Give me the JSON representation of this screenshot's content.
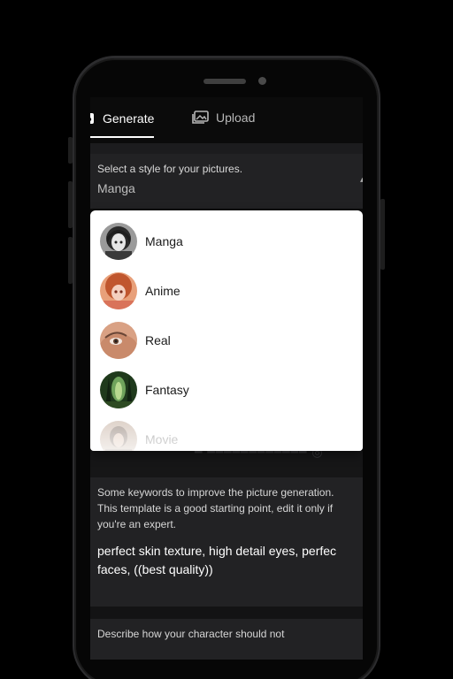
{
  "tabs": [
    {
      "label": "Generate",
      "icon": "generate-icon",
      "active": true
    },
    {
      "label": "Upload",
      "icon": "image-upload-icon",
      "active": false
    }
  ],
  "style_select": {
    "label": "Select a style for your pictures.",
    "value": "Manga"
  },
  "style_options": [
    {
      "label": "Manga",
      "icon": "manga-thumbnail"
    },
    {
      "label": "Anime",
      "icon": "anime-thumbnail"
    },
    {
      "label": "Real",
      "icon": "real-thumbnail"
    },
    {
      "label": "Fantasy",
      "icon": "fantasy-thumbnail"
    },
    {
      "label": "Movie",
      "icon": "movie-thumbnail"
    }
  ],
  "keywords": {
    "help": "Some keywords to improve the picture generation. This template is a good starting point, edit it only if you're an expert.",
    "value": "perfect skin texture, high detail eyes, perfect faces, ((best quality))",
    "line1": "perfect skin texture, high detail eyes, perfec",
    "line2": "faces, ((best quality))"
  },
  "negative": {
    "help": "Describe how your character should not"
  },
  "colors": {
    "background": "#000000",
    "card": "#222224",
    "dropdown": "#ffffff",
    "active_tab": "#ffffff"
  }
}
